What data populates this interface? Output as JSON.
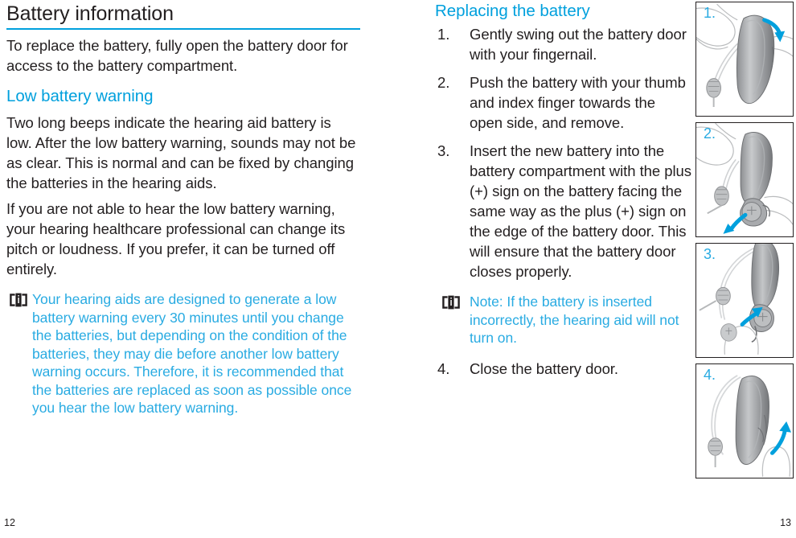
{
  "accent_color": "#00a0dd",
  "note_color": "#29ABE2",
  "text_color": "#231f20",
  "left_page": {
    "title": "Battery information",
    "intro": "To replace the battery, fully open the battery door for access to the battery compartment.",
    "subhead": "Low battery warning",
    "paragraphs": [
      "Two long beeps indicate the hearing aid battery is low. After the low battery warning, sounds may not be as clear. This is normal and can be fixed by changing the batteries in the hearing aids.",
      "If you are not able to hear the low battery warning, your hearing healthcare professional can change its pitch or loudness. If you prefer, it can be turned off entirely."
    ],
    "note": {
      "icon": "consult-instructions-for-use-icon",
      "text": "Your hearing aids are designed to generate a low battery warning every 30 minutes until you change the batteries, but depending on the condition of the batteries, they may die before another low battery warning occurs. Therefore, it is recommended that the batteries are replaced as soon as possible once you hear the low battery warning."
    },
    "folio": "12"
  },
  "right_page": {
    "subhead": "Replacing the battery",
    "steps": [
      {
        "num": "1.",
        "text": "Gently swing out the battery door with your fingernail."
      },
      {
        "num": "2.",
        "text": "Push the battery with your thumb and index finger towards the open side, and remove."
      },
      {
        "num": "3.",
        "text": "Insert the new battery into the battery compartment with the plus (+) sign on the battery facing the same way as the plus (+) sign on the edge of the battery door. This will ensure that the battery door closes properly."
      }
    ],
    "note": {
      "icon": "consult-instructions-for-use-icon",
      "text": "Note: If the battery is inserted incorrectly, the hearing aid will not turn on."
    },
    "final_step": {
      "num": "4.",
      "text": "Close the battery door."
    },
    "figures": [
      {
        "label": "1.",
        "caption": "hearing-aid-swing-open-battery-door"
      },
      {
        "label": "2.",
        "caption": "hearing-aid-push-battery-out"
      },
      {
        "label": "3.",
        "caption": "hearing-aid-insert-new-battery"
      },
      {
        "label": "4.",
        "caption": "hearing-aid-close-battery-door"
      }
    ],
    "folio": "13"
  }
}
